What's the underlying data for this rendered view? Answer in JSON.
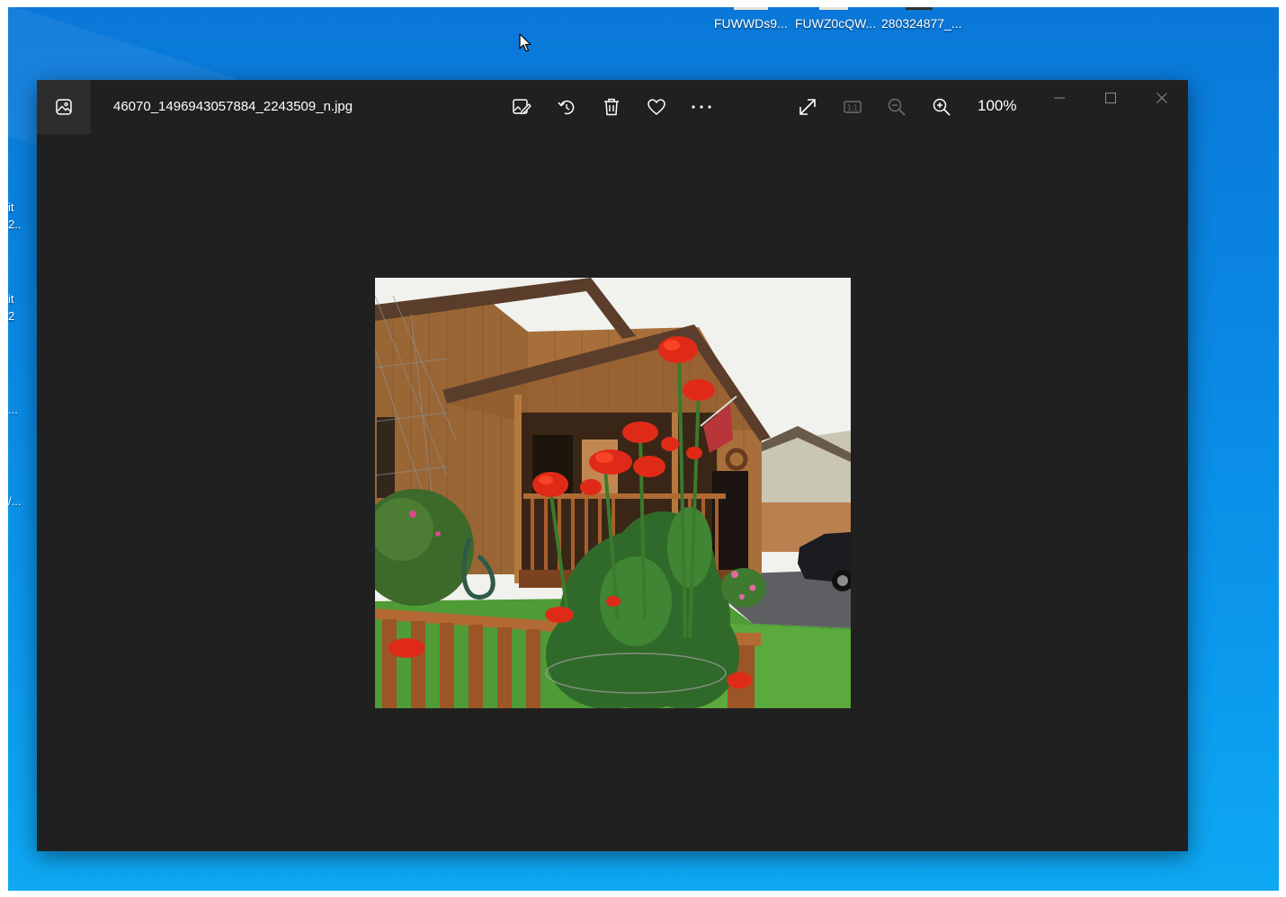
{
  "desktop": {
    "icons": [
      {
        "label": "FUWWDs9..."
      },
      {
        "label": "FUWZ0cQW..."
      },
      {
        "label": "280324877_..."
      }
    ],
    "edge_fragments": [
      "it",
      "2...",
      "it",
      "2",
      "...",
      "/..."
    ]
  },
  "viewer": {
    "app_icon": "photos-app-icon",
    "filename": "46070_1496943057884_2243509_n.jpg",
    "toolbar": {
      "edit_icon": "edit-image-icon",
      "rotate_icon": "rotate-icon",
      "delete_icon": "trash-icon",
      "favorite_icon": "heart-icon",
      "more_icon": "more-icon",
      "fullscreen_icon": "expand-icon",
      "actual_size_icon": "actual-size-icon",
      "actual_size_label": "1:1",
      "zoom_out_icon": "zoom-out-icon",
      "zoom_in_icon": "zoom-in-icon",
      "zoom_level": "100%"
    },
    "window_controls": [
      "minimize-icon",
      "maximize-icon",
      "close-icon"
    ],
    "colors": {
      "window_bg": "#202020",
      "app_icon_bg": "#2d2d2d",
      "desktop_accent": "#0a86e2"
    }
  }
}
